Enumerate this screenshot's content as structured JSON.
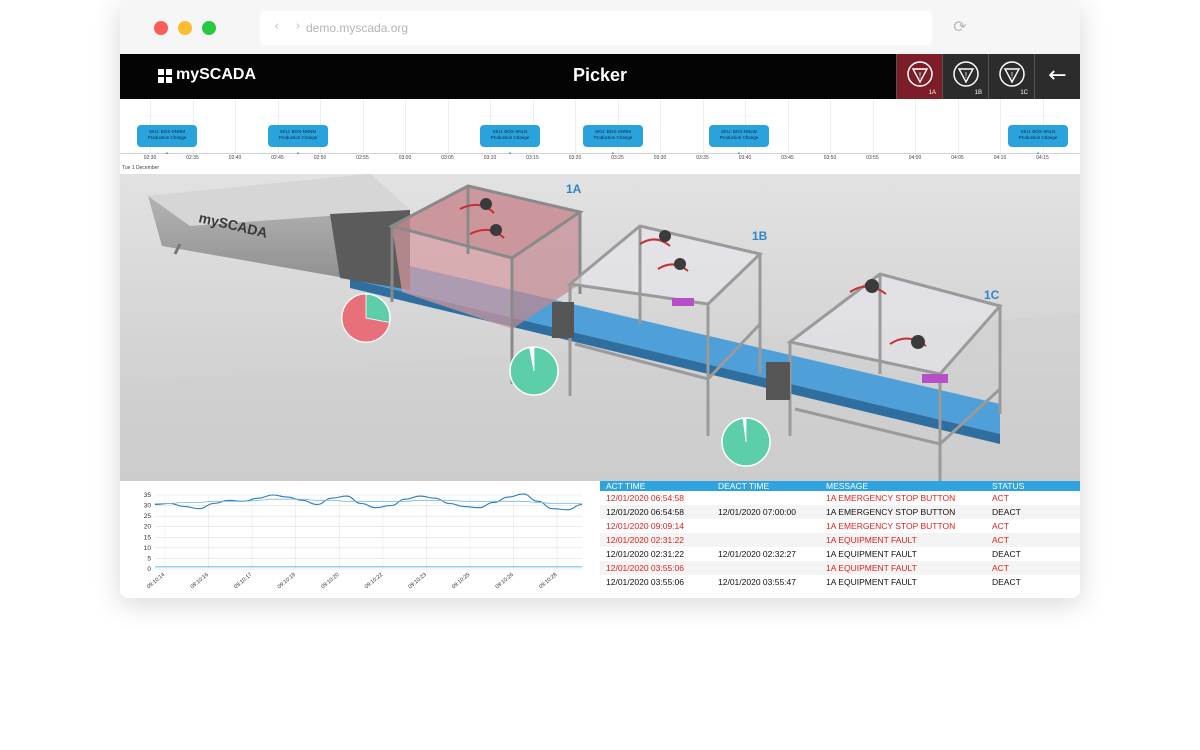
{
  "browser": {
    "url": "demo.myscada.org",
    "nav_arrows": "‹ ›",
    "reload": "⟳"
  },
  "header": {
    "logo_text": "mySCADA",
    "title": "Picker",
    "alarm_buttons": [
      {
        "label": "1A",
        "icon": "emergency-stop-icon",
        "active": true
      },
      {
        "label": "1B",
        "icon": "emergency-stop-icon",
        "active": false
      },
      {
        "label": "1C",
        "icon": "emergency-stop-icon",
        "active": false
      }
    ],
    "back_label": "←"
  },
  "timeline": {
    "date": "Tue 1 December",
    "ticks": [
      "02:30",
      "02:35",
      "02:40",
      "02:45",
      "02:50",
      "02:55",
      "03:00",
      "03:05",
      "03:10",
      "03:15",
      "03:20",
      "03:25",
      "03:30",
      "03:35",
      "03:40",
      "03:45",
      "03:50",
      "03:55",
      "04:00",
      "04:05",
      "04:10",
      "04:15"
    ],
    "events": [
      {
        "sku": "SKU: BOX-SNNM",
        "text": "Production Change"
      },
      {
        "sku": "SKU: BOX-NNNM",
        "text": "Production Change"
      },
      {
        "sku": "SKU: BOX-SNLN",
        "text": "Production Change"
      },
      {
        "sku": "SKU: BOX-SNNM",
        "text": "Production Change"
      },
      {
        "sku": "SKU: BOX-NNLW",
        "text": "Production Change"
      },
      {
        "sku": "SKU: BOX-SNLN",
        "text": "Production Change"
      }
    ]
  },
  "scene": {
    "labels": [
      "1A",
      "1B",
      "1C"
    ],
    "brand": "mySCADA",
    "pies": [
      {
        "value": 0.72,
        "color": "#e8707a",
        "rest": "#5ccfaa"
      },
      {
        "value": 0.03,
        "color": "#ffffff",
        "rest": "#5ccfaa"
      },
      {
        "value": 0.02,
        "color": "#ffffff",
        "rest": "#5ccfaa"
      }
    ]
  },
  "chart_data": {
    "type": "line",
    "yticks": [
      "35",
      "30",
      "25",
      "20",
      "15",
      "10",
      "5",
      "0"
    ],
    "ylim": [
      0,
      35
    ],
    "xticks": [
      "09:10:14",
      "09:10:16",
      "09:10:17",
      "09:10:19",
      "09:10:20",
      "09:10:22",
      "09:10:23",
      "09:10:25",
      "09:10:26",
      "09:10:28"
    ],
    "series": [
      {
        "color": "#2a7cc0",
        "values": [
          30.5,
          31,
          29.5,
          28.5,
          31,
          32.5,
          32,
          33.5,
          35,
          34,
          32.5,
          30.5,
          33.5,
          34.5,
          31,
          29,
          30,
          33,
          34.5,
          33.5,
          31,
          29.5,
          29,
          31.5,
          34,
          35.5,
          32,
          28.5,
          28,
          30.5
        ]
      },
      {
        "color": "#7ab8e0",
        "values": [
          31,
          31,
          31.5,
          31.5,
          32,
          32,
          32,
          32.5,
          33,
          33,
          33,
          32.5,
          32.5,
          32,
          32,
          32,
          32,
          32,
          32.5,
          32.5,
          32.5,
          32,
          32,
          32,
          32,
          32,
          31.5,
          31,
          31,
          31
        ]
      },
      {
        "color": "#2ea3e0",
        "values": [
          1,
          1,
          1,
          1,
          1,
          1,
          1,
          1,
          1,
          1,
          1,
          1,
          1,
          1,
          1,
          1,
          1,
          1,
          1,
          1,
          1,
          1,
          1,
          1,
          1,
          1,
          1,
          1,
          1,
          1
        ]
      }
    ]
  },
  "alarms": {
    "columns": [
      "ACT TIME",
      "DEACT TIME",
      "MESSAGE",
      "STATUS"
    ],
    "rows": [
      {
        "act": "12/01/2020 06:54:58",
        "deact": "",
        "message": "1A EMERGENCY STOP BUTTON",
        "status": "ACT",
        "active": true
      },
      {
        "act": "12/01/2020 06:54:58",
        "deact": "12/01/2020 07:00:00",
        "message": "1A EMERGENCY STOP BUTTON",
        "status": "DEACT",
        "active": false
      },
      {
        "act": "12/01/2020 09:09:14",
        "deact": "",
        "message": "1A EMERGENCY STOP BUTTON",
        "status": "ACT",
        "active": true
      },
      {
        "act": "12/01/2020 02:31:22",
        "deact": "",
        "message": "1A EQUIPMENT FAULT",
        "status": "ACT",
        "active": true
      },
      {
        "act": "12/01/2020 02:31:22",
        "deact": "12/01/2020 02:32:27",
        "message": "1A EQUIPMENT FAULT",
        "status": "DEACT",
        "active": false
      },
      {
        "act": "12/01/2020 03:55:06",
        "deact": "",
        "message": "1A EQUIPMENT FAULT",
        "status": "ACT",
        "active": true
      },
      {
        "act": "12/01/2020 03:55:06",
        "deact": "12/01/2020 03:55:47",
        "message": "1A EQUIPMENT FAULT",
        "status": "DEACT",
        "active": false
      }
    ]
  }
}
